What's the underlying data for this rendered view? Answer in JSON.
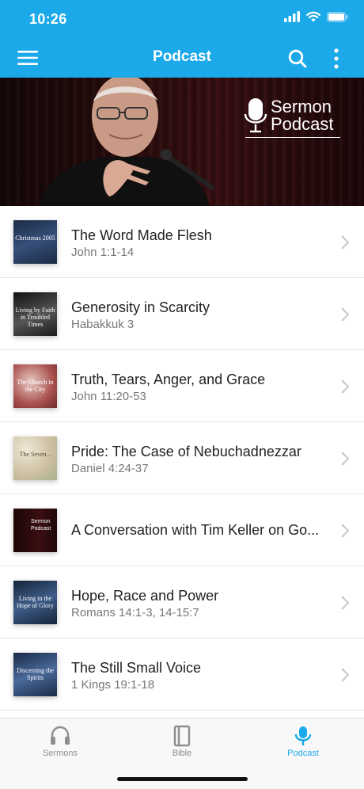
{
  "status": {
    "time": "10:26"
  },
  "header": {
    "title": "Podcast"
  },
  "hero": {
    "logo_line1": "Sermon",
    "logo_line2": "Podcast"
  },
  "episodes": [
    {
      "title": "The Word Made Flesh",
      "subtitle": "John 1:1-14",
      "thumb_text": "Christmas 2005",
      "thumb_color": "#2b3e5a"
    },
    {
      "title": "Generosity in Scarcity",
      "subtitle": "Habakkuk 3",
      "thumb_text": "Living by Faith in Troubled Times",
      "thumb_color": "#3a3a3a"
    },
    {
      "title": "Truth, Tears, Anger, and Grace",
      "subtitle": "John 11:20-53",
      "thumb_text": "The Church in the City",
      "thumb_color": "#8a3a3a"
    },
    {
      "title": "Pride: The Case of Nebuchadnezzar",
      "subtitle": "Daniel 4:24-37",
      "thumb_text": "The Seven...",
      "thumb_color": "#d8cdb8"
    },
    {
      "title": "A Conversation with Tim Keller on Go...",
      "subtitle": "",
      "thumb_text": "Sermon Podcast",
      "thumb_color": "#2a0c0c"
    },
    {
      "title": "Hope, Race and Power",
      "subtitle": "Romans 14:1-3, 14-15:7",
      "thumb_text": "Living in the Hope of Glory",
      "thumb_color": "#24354e"
    },
    {
      "title": "The Still Small Voice",
      "subtitle": "1 Kings 19:1-18",
      "thumb_text": "Discerning the Spirits",
      "thumb_color": "#2a3c5c"
    }
  ],
  "tabs": [
    {
      "label": "Sermons",
      "icon": "headphones-icon",
      "active": false
    },
    {
      "label": "Bible",
      "icon": "book-icon",
      "active": false
    },
    {
      "label": "Podcast",
      "icon": "microphone-icon",
      "active": true
    }
  ],
  "colors": {
    "accent": "#1ba9e9",
    "inactive": "#8e8e8e"
  }
}
